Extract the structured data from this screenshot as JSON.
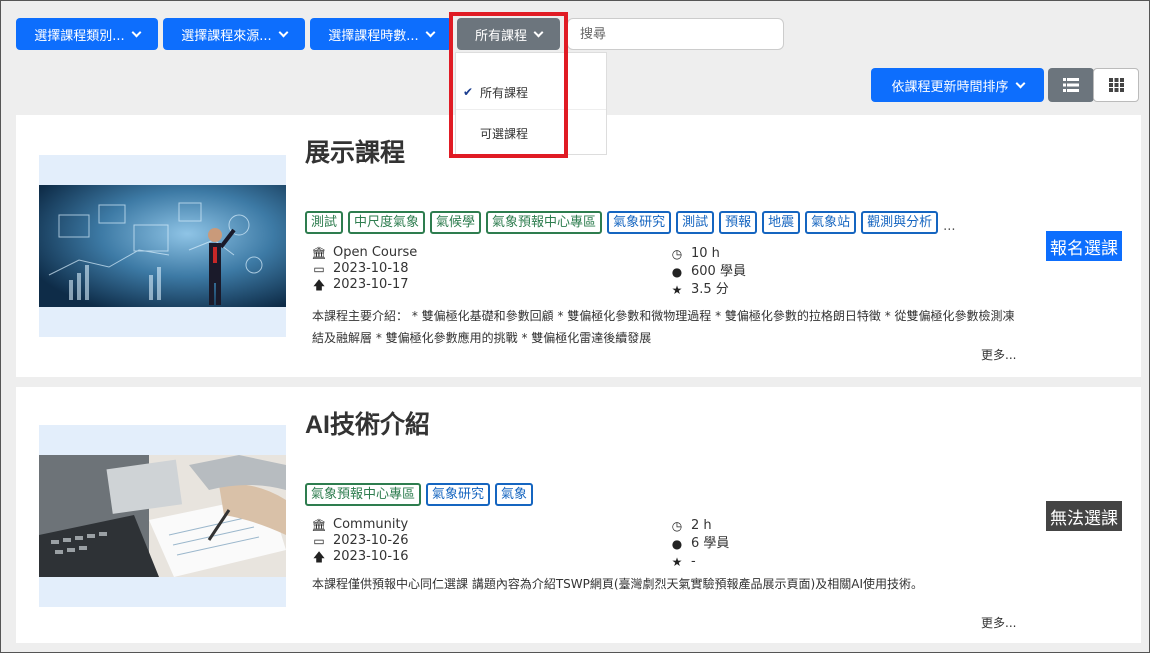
{
  "filters": {
    "category": "選擇課程類別...",
    "source": "選擇課程來源...",
    "duration": "選擇課程時數...",
    "status": "所有課程"
  },
  "search": {
    "placeholder": "搜尋"
  },
  "dropdown": {
    "items": [
      {
        "label": "所有課程",
        "selected": true
      },
      {
        "label": "可選課程",
        "selected": false
      }
    ]
  },
  "sort": {
    "label": "依課程更新時間排序"
  },
  "view": {
    "active": "list"
  },
  "courses": [
    {
      "title": "展示課程",
      "tags": [
        {
          "label": "測試",
          "color": "green"
        },
        {
          "label": "中尺度氣象",
          "color": "green"
        },
        {
          "label": "氣候學",
          "color": "green"
        },
        {
          "label": "氣象預報中心專區",
          "color": "green"
        },
        {
          "label": "氣象研究",
          "color": "blue"
        },
        {
          "label": "測試",
          "color": "blue"
        },
        {
          "label": "預報",
          "color": "blue"
        },
        {
          "label": "地震",
          "color": "blue"
        },
        {
          "label": "氣象站",
          "color": "blue"
        },
        {
          "label": "觀測與分析",
          "color": "blue"
        }
      ],
      "tags_more": "...",
      "source": "Open Course",
      "start_date": "2023-10-18",
      "updated_date": "2023-10-17",
      "hours": "10 h",
      "students": "600 學員",
      "rating": "3.5 分",
      "description": "本課程主要介紹： * 雙偏極化基礎和參數回顧 * 雙偏極化參數和微物理過程 * 雙偏極化參數的拉格朗日特徵 * 從雙偏極化參數檢測凍結及融解層 * 雙偏極化參數應用的挑戰 * 雙偏極化雷達後續發展",
      "more": "更多...",
      "action": "報名選課",
      "action_color": "#0d6efd"
    },
    {
      "title": "AI技術介紹",
      "tags": [
        {
          "label": "氣象預報中心專區",
          "color": "green"
        },
        {
          "label": "氣象研究",
          "color": "blue"
        },
        {
          "label": "氣象",
          "color": "blue"
        }
      ],
      "tags_more": "",
      "source": "Community",
      "start_date": "2023-10-26",
      "updated_date": "2023-10-16",
      "hours": "2 h",
      "students": "6 學員",
      "rating": "-",
      "description": "本課程僅供預報中心同仁選課 講題內容為介紹TSWP網頁(臺灣劇烈天氣實驗預報產品展示頁面)及相關AI使用技術。",
      "more": "更多...",
      "action": "無法選課",
      "action_color": "#444444"
    }
  ],
  "icons": {
    "source": "institution-icon",
    "date": "calendar-icon",
    "updated": "arrow-up-icon",
    "hours": "clock-icon",
    "students": "user-icon",
    "rating": "star-icon"
  }
}
